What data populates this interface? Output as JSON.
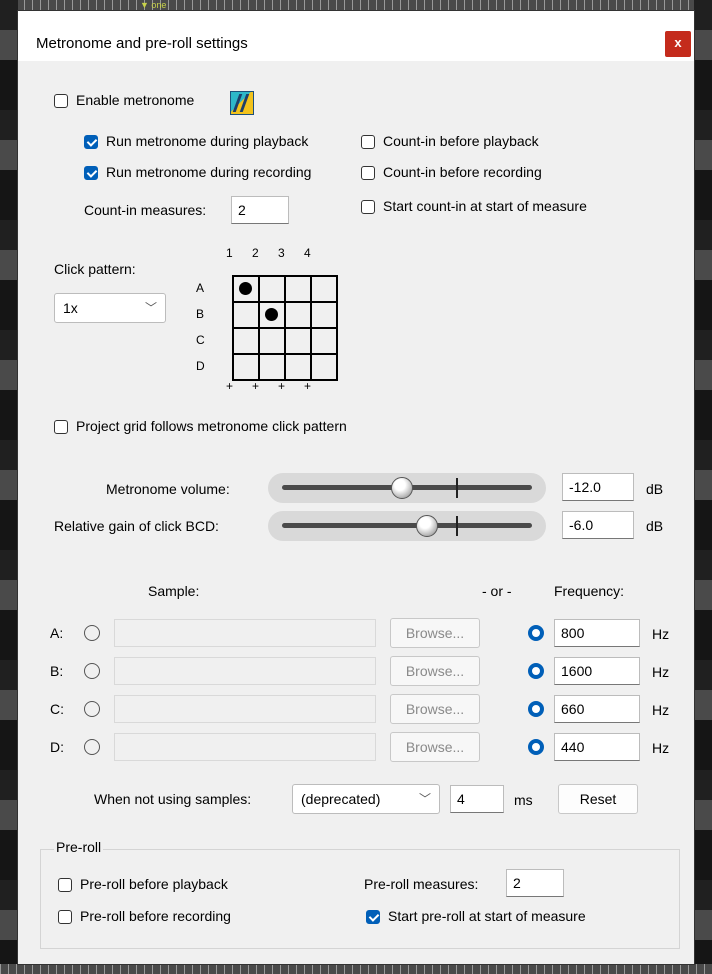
{
  "background": {
    "marker_label": "one"
  },
  "dialog": {
    "title": "Metronome and pre-roll settings",
    "close_label": "x"
  },
  "metronome": {
    "enable_label": "Enable metronome",
    "enable_checked": false,
    "run_playback_label": "Run metronome during playback",
    "run_playback_checked": true,
    "run_recording_label": "Run metronome during recording",
    "run_recording_checked": true,
    "countin_playback_label": "Count-in before playback",
    "countin_playback_checked": false,
    "countin_recording_label": "Count-in before recording",
    "countin_recording_checked": false,
    "countin_start_label": "Start count-in at start of measure",
    "countin_start_checked": false,
    "countin_measures_label": "Count-in measures:",
    "countin_measures_value": "2"
  },
  "click_pattern": {
    "label": "Click pattern:",
    "select_value": "1x",
    "columns": [
      "1",
      "2",
      "3",
      "4"
    ],
    "rows": [
      "A",
      "B",
      "C",
      "D"
    ],
    "bottom_marks": [
      "+",
      "+",
      "+",
      "+"
    ],
    "active": [
      [
        1,
        0,
        0,
        0
      ],
      [
        0,
        1,
        0,
        0
      ],
      [
        0,
        0,
        0,
        0
      ],
      [
        0,
        0,
        0,
        0
      ]
    ]
  },
  "project_grid": {
    "label": "Project grid follows metronome click pattern",
    "checked": false
  },
  "volume": {
    "label": "Metronome volume:",
    "value": "-12.0",
    "unit": "dB",
    "slider_fraction": 0.48
  },
  "relative_gain": {
    "label": "Relative gain of click BCD:",
    "value": "-6.0",
    "unit": "dB",
    "slider_fraction": 0.58
  },
  "samples": {
    "sample_header": "Sample:",
    "or_label": "- or -",
    "frequency_header": "Frequency:",
    "browse_label": "Browse...",
    "hz_label": "Hz",
    "rows": [
      {
        "label": "A:",
        "frequency": "800"
      },
      {
        "label": "B:",
        "frequency": "1600"
      },
      {
        "label": "C:",
        "frequency": "660"
      },
      {
        "label": "D:",
        "frequency": "440"
      }
    ]
  },
  "not_using_samples": {
    "label": "When not using samples:",
    "select_value": "(deprecated)",
    "ms_value": "4",
    "ms_label": "ms",
    "reset_label": "Reset"
  },
  "preroll": {
    "group_label": "Pre-roll",
    "before_playback_label": "Pre-roll before playback",
    "before_playback_checked": false,
    "before_recording_label": "Pre-roll before recording",
    "before_recording_checked": false,
    "measures_label": "Pre-roll measures:",
    "measures_value": "2",
    "start_measure_label": "Start pre-roll at start of measure",
    "start_measure_checked": true
  },
  "colors": {
    "accent": "#005fb8",
    "close": "#c42b1c",
    "dialog_bg": "#f0f0f0"
  }
}
